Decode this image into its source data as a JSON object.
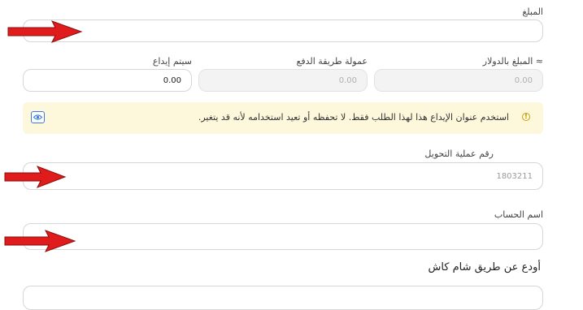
{
  "amount": {
    "label": "المبلغ",
    "value": ""
  },
  "usd_amount": {
    "label": "المبلغ بالدولار ≈",
    "value": "0.00"
  },
  "payment_fee": {
    "label": "عمولة طريقة الدفع",
    "value": "0.00"
  },
  "deposit_total": {
    "label": "سيتم إيداع",
    "value": "0.00"
  },
  "notice": {
    "text": "استخدم عنوان الإيداع هذا لهذا الطلب فقط. لا تحفظه أو تعيد استخدامه لأنه قد يتغير.",
    "icon": "warning-circle-icon",
    "action_icon": "eye-icon"
  },
  "transfer_number": {
    "label": "رقم عملية التحويل",
    "value": "1803211"
  },
  "account_name": {
    "label": "اسم الحساب",
    "value": ""
  },
  "section": {
    "title": "أودع عن طريق شام كاش"
  },
  "colors": {
    "arrow": "#e01b1b",
    "notice_bg": "#fdf7dc",
    "eye_accent": "#3b7be0"
  }
}
